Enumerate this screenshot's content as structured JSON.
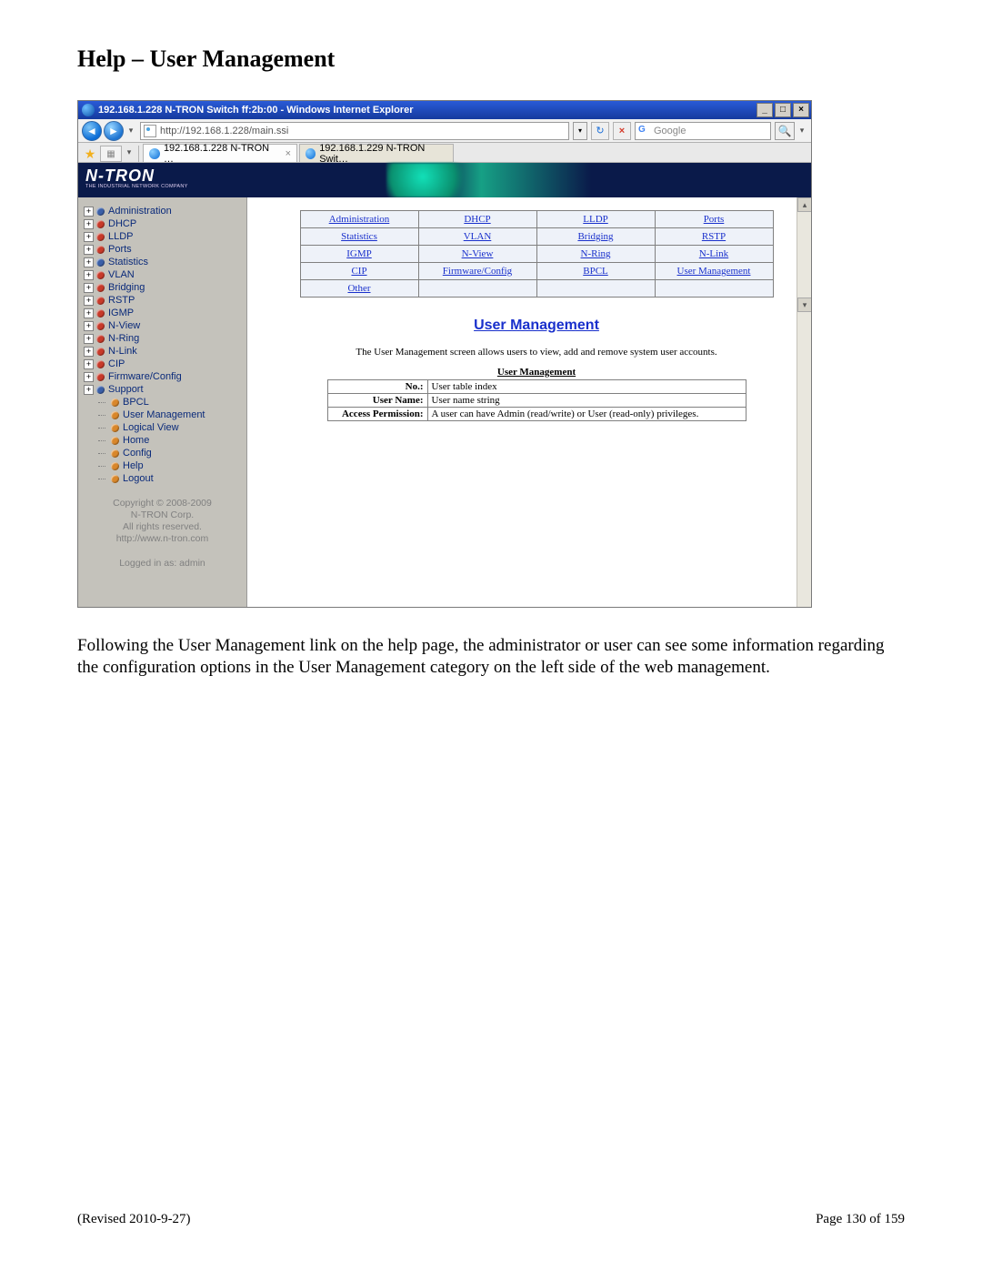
{
  "doc": {
    "heading": "Help – User Management",
    "following_text": "Following the User Management link on the help page, the administrator or user can see some information regarding the configuration options in the User Management category on the left side of the web management.",
    "revised": "(Revised 2010-9-27)",
    "page_indicator": "Page 130 of 159"
  },
  "browser": {
    "window_title": "192.168.1.228 N-TRON Switch ff:2b:00 - Windows Internet Explorer",
    "url": "http://192.168.1.228/main.ssi",
    "search_placeholder": "Google",
    "tabs": [
      {
        "label": "192.168.1.228 N-TRON …",
        "active": true,
        "closable": true
      },
      {
        "label": "192.168.1.229 N-TRON Swit…",
        "active": false,
        "closable": false
      }
    ]
  },
  "banner": {
    "logo_main": "N-TRON",
    "logo_tag": "THE INDUSTRIAL NETWORK COMPANY"
  },
  "sidebar": {
    "tree_top": [
      {
        "label": "Administration",
        "bullet": "b-blue",
        "expandable": true
      },
      {
        "label": "DHCP",
        "bullet": "b-red",
        "expandable": true
      },
      {
        "label": "LLDP",
        "bullet": "b-red",
        "expandable": true
      },
      {
        "label": "Ports",
        "bullet": "b-red",
        "expandable": true
      },
      {
        "label": "Statistics",
        "bullet": "b-blue",
        "expandable": true
      },
      {
        "label": "VLAN",
        "bullet": "b-red",
        "expandable": true
      },
      {
        "label": "Bridging",
        "bullet": "b-red",
        "expandable": true
      },
      {
        "label": "RSTP",
        "bullet": "b-red",
        "expandable": true
      },
      {
        "label": "IGMP",
        "bullet": "b-red",
        "expandable": true
      },
      {
        "label": "N-View",
        "bullet": "b-red",
        "expandable": true
      },
      {
        "label": "N-Ring",
        "bullet": "b-red",
        "expandable": true
      },
      {
        "label": "N-Link",
        "bullet": "b-red",
        "expandable": true
      },
      {
        "label": "CIP",
        "bullet": "b-red",
        "expandable": true
      },
      {
        "label": "Firmware/Config",
        "bullet": "b-red",
        "expandable": true
      },
      {
        "label": "Support",
        "bullet": "b-blue",
        "expandable": true
      }
    ],
    "tree_sub": [
      {
        "label": "BPCL",
        "bullet": "b-orange"
      },
      {
        "label": "User Management",
        "bullet": "b-orange"
      },
      {
        "label": "Logical View",
        "bullet": "b-orange"
      },
      {
        "label": "Home",
        "bullet": "b-orange"
      },
      {
        "label": "Config",
        "bullet": "b-orange"
      },
      {
        "label": "Help",
        "bullet": "b-orange"
      },
      {
        "label": "Logout",
        "bullet": "b-orange"
      }
    ],
    "copyright_lines": [
      "Copyright © 2008-2009",
      "N-TRON Corp.",
      "All rights reserved.",
      "http://www.n-tron.com"
    ],
    "logged_in": "Logged in as: admin"
  },
  "navgrid": {
    "rows": [
      [
        "Administration",
        "DHCP",
        "LLDP",
        "Ports"
      ],
      [
        "Statistics",
        "VLAN",
        "Bridging",
        "RSTP"
      ],
      [
        "IGMP",
        "N-View",
        "N-Ring",
        "N-Link"
      ],
      [
        "CIP",
        "Firmware/Config",
        "BPCL",
        "User Management"
      ],
      [
        "Other",
        "",
        "",
        ""
      ]
    ]
  },
  "section": {
    "title": "User Management",
    "description": "The User Management screen allows users to view, add and remove system user accounts.",
    "table_caption": "User Management",
    "defs": [
      {
        "k": "No.:",
        "v": "User table index"
      },
      {
        "k": "User Name:",
        "v": "User name string"
      },
      {
        "k": "Access Permission:",
        "v": "A user can have Admin (read/write) or User (read-only) privileges."
      }
    ]
  }
}
